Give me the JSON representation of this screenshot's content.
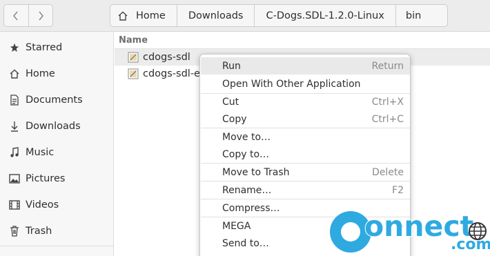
{
  "header": {
    "back_icon": "chevron-left-icon",
    "forward_icon": "chevron-right-icon",
    "breadcrumbs": [
      "Home",
      "Downloads",
      "C-Dogs.SDL-1.2.0-Linux",
      "bin"
    ]
  },
  "sidebar": {
    "items": [
      {
        "label": "Starred",
        "icon": "star-icon"
      },
      {
        "label": "Home",
        "icon": "home-icon"
      },
      {
        "label": "Documents",
        "icon": "document-icon"
      },
      {
        "label": "Downloads",
        "icon": "download-icon"
      },
      {
        "label": "Music",
        "icon": "music-icon"
      },
      {
        "label": "Pictures",
        "icon": "picture-icon"
      },
      {
        "label": "Videos",
        "icon": "video-icon"
      },
      {
        "label": "Trash",
        "icon": "trash-icon"
      }
    ]
  },
  "filelist": {
    "column_name": "Name",
    "files": [
      {
        "name": "cdogs-sdl",
        "selected": true
      },
      {
        "name": "cdogs-sdl-ed",
        "selected": false
      }
    ]
  },
  "context_menu": {
    "items": [
      {
        "label": "Run",
        "accel": "Return"
      },
      {
        "label": "Open With Other Application",
        "accel": ""
      },
      {
        "label": "Cut",
        "accel": "Ctrl+X"
      },
      {
        "label": "Copy",
        "accel": "Ctrl+C"
      },
      {
        "label": "Move to…",
        "accel": ""
      },
      {
        "label": "Copy to…",
        "accel": ""
      },
      {
        "label": "Move to Trash",
        "accel": "Delete"
      },
      {
        "label": "Rename…",
        "accel": "F2"
      },
      {
        "label": "Compress…",
        "accel": ""
      },
      {
        "label": "MEGA",
        "accel": ""
      },
      {
        "label": "Send to…",
        "accel": ""
      }
    ]
  },
  "watermark": {
    "text": "onnect",
    "suffix": ".com",
    "color": "#2eaae1"
  }
}
